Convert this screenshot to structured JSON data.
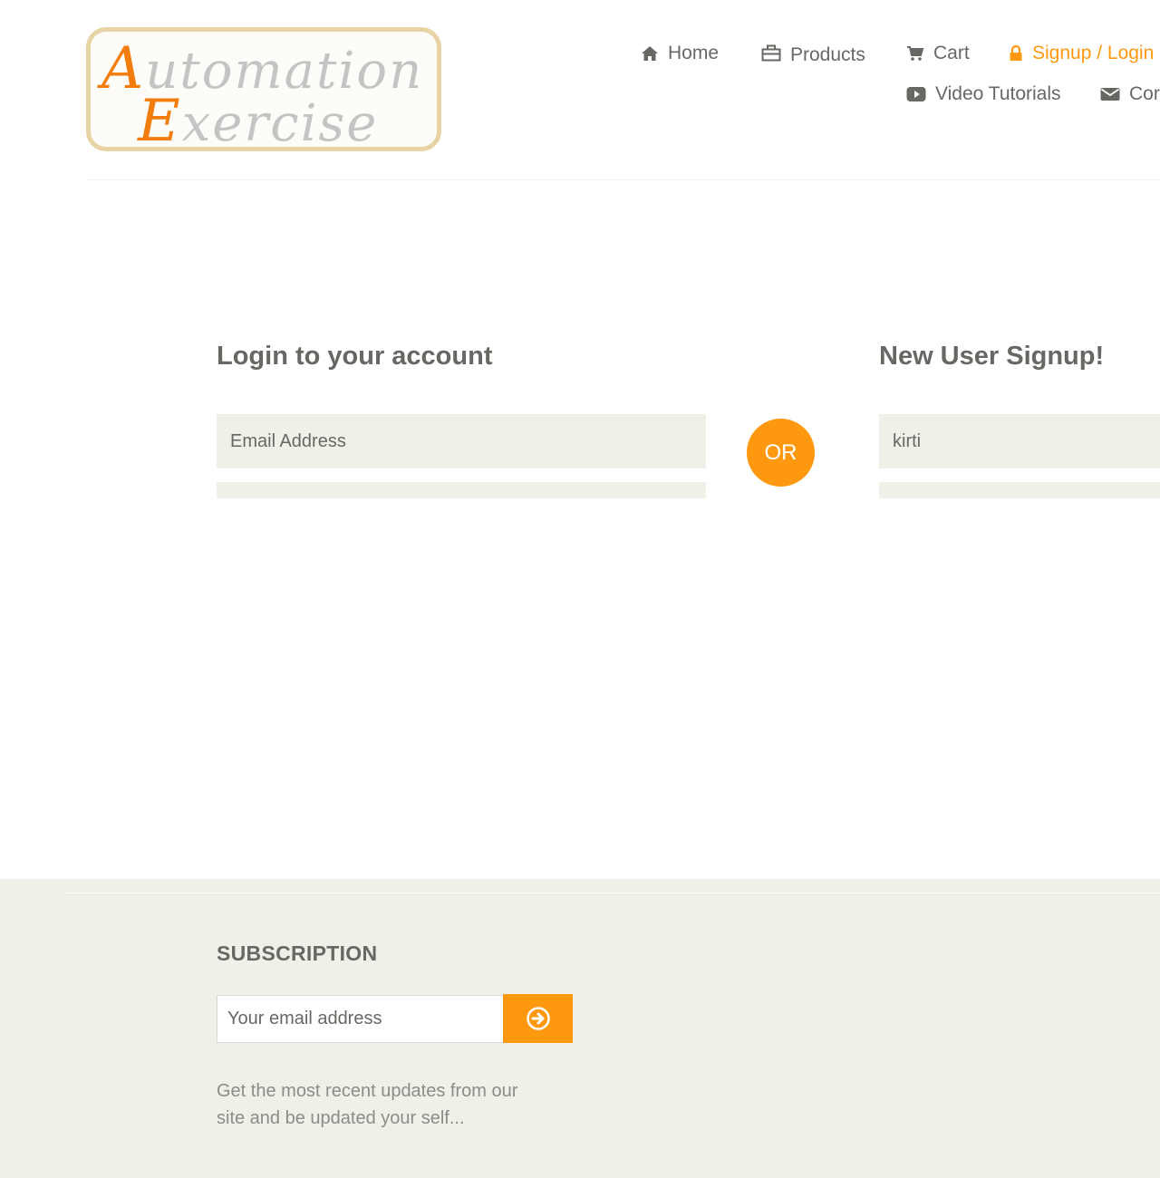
{
  "logo": {
    "line1_first": "A",
    "line1_rest": "utomation",
    "line2_first": "E",
    "line2_rest": "xercise"
  },
  "nav": {
    "home": "Home",
    "products": "Products",
    "cart": "Cart",
    "signup_login": "Signup / Login",
    "video_tutorials": "Video Tutorials",
    "contact": "Cor"
  },
  "login": {
    "title": "Login to your account",
    "email_placeholder": "Email Address"
  },
  "or_label": "OR",
  "signup": {
    "title": "New User Signup!",
    "name_value": "kirti"
  },
  "footer": {
    "subscription_title": "SUBSCRIPTION",
    "email_placeholder": "Your email address",
    "description": "Get the most recent updates from our site and be updated your self..."
  },
  "colors": {
    "accent": "#fe980f",
    "text": "#696763",
    "field_bg": "#f0f0e9"
  },
  "icons": [
    "home-icon",
    "briefcase-icon",
    "cart-icon",
    "lock-icon",
    "youtube-play-icon",
    "envelope-icon",
    "arrow-circle-right-icon"
  ]
}
